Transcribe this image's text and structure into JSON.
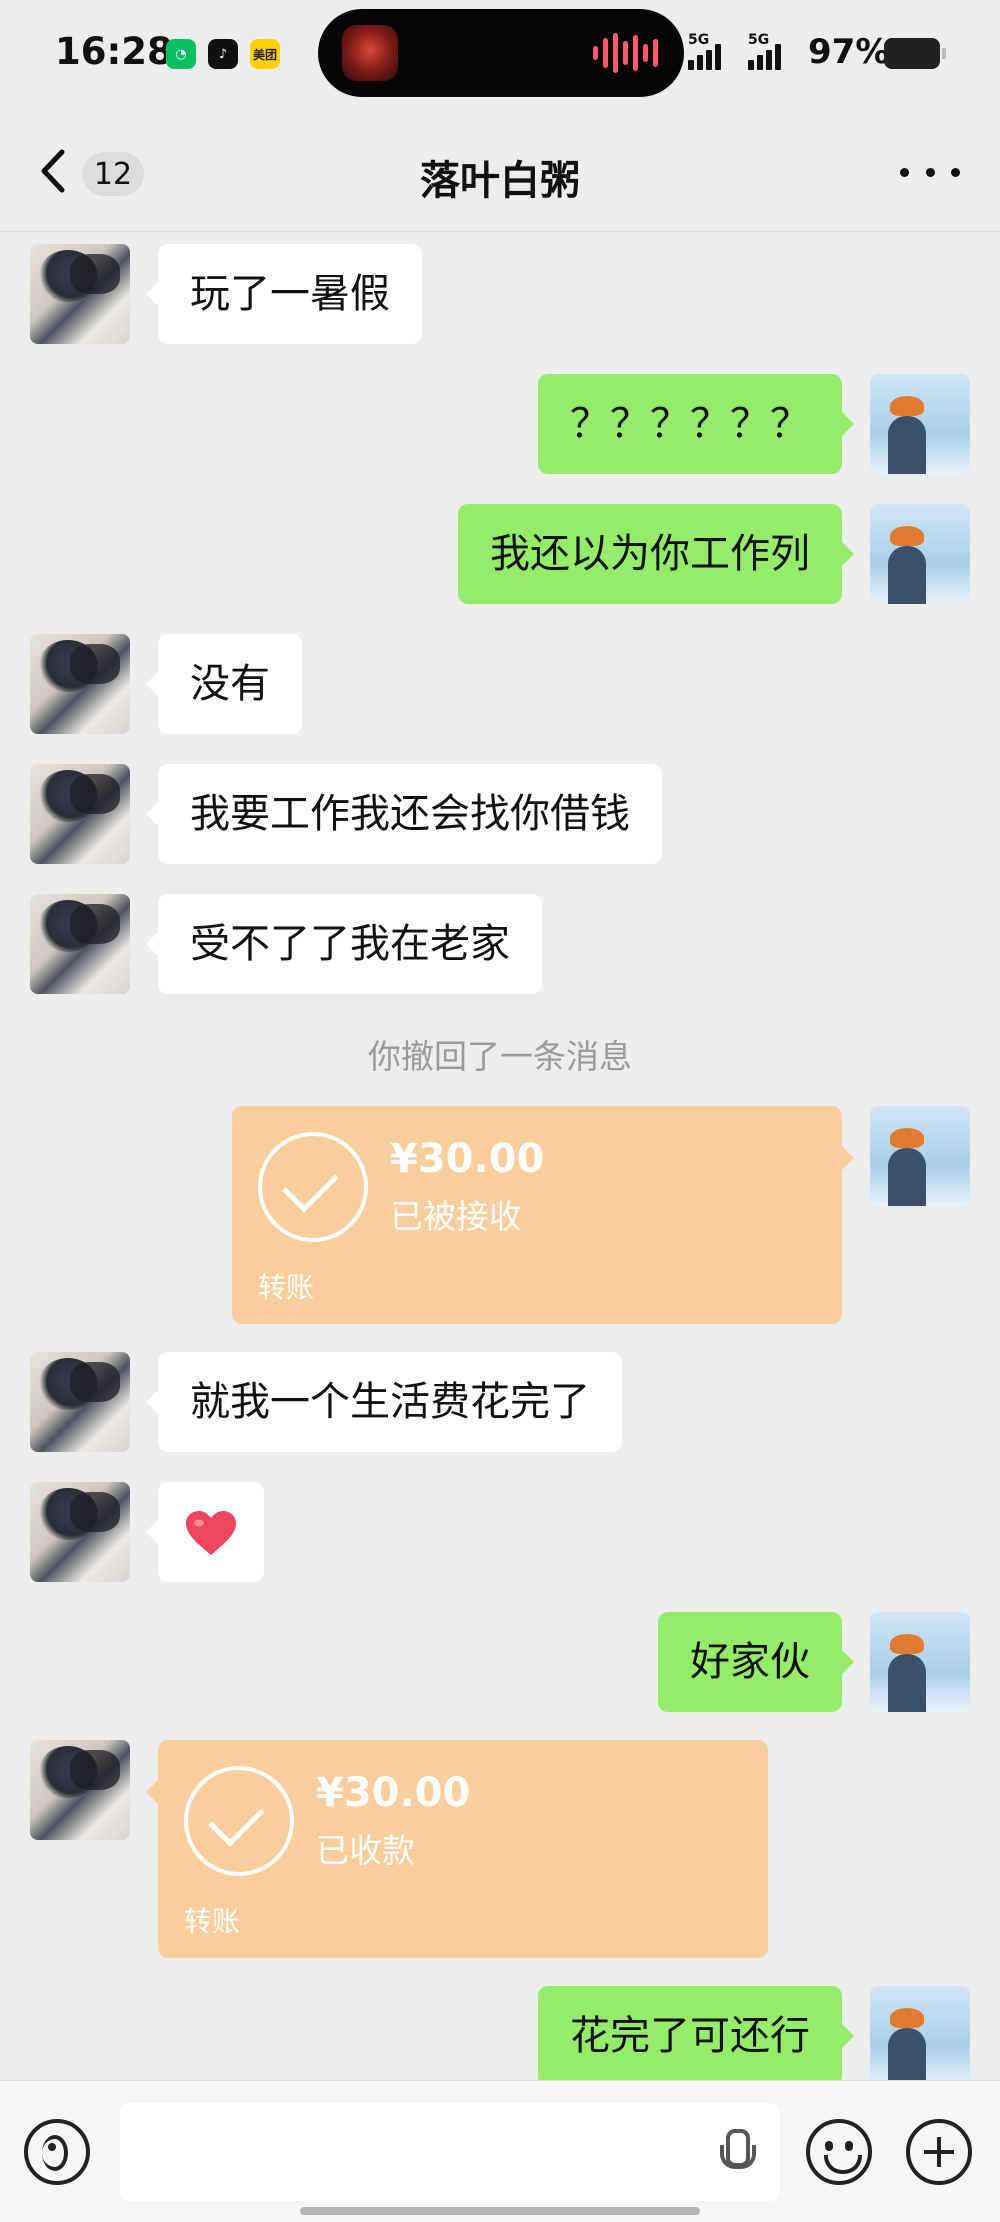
{
  "status_bar": {
    "time": "16:28",
    "app_icons": [
      {
        "name": "wechat-app-icon",
        "color": "#07c160",
        "glyph": "◔"
      },
      {
        "name": "tiktok-app-icon",
        "color": "#111111",
        "glyph": "♪"
      },
      {
        "name": "meituan-app-icon",
        "color": "#ffd100",
        "glyph": "美团"
      }
    ],
    "signal_label_1": "5G",
    "signal_label_2": "5G",
    "battery_percent": "97%",
    "battery_level": 0.97
  },
  "header": {
    "back_icon": "chevron-left-icon",
    "unread_count": "12",
    "title": "落叶白粥",
    "more_icon": "ellipsis-icon"
  },
  "messages": [
    {
      "sender": "friend",
      "type": "text",
      "text": "玩了一暑假"
    },
    {
      "sender": "me",
      "type": "text",
      "text": "？？？？？？"
    },
    {
      "sender": "me",
      "type": "text",
      "text": "我还以为你工作列"
    },
    {
      "sender": "friend",
      "type": "text",
      "text": "没有"
    },
    {
      "sender": "friend",
      "type": "text",
      "text": "我要工作我还会找你借钱"
    },
    {
      "sender": "friend",
      "type": "text",
      "text": "受不了了我在老家"
    },
    {
      "sender": "system",
      "type": "notice",
      "text": "你撤回了一条消息"
    },
    {
      "sender": "me",
      "type": "transfer",
      "amount": "¥30.00",
      "status": "已被接收",
      "label": "转账"
    },
    {
      "sender": "friend",
      "type": "text",
      "text": "就我一个生活费花完了"
    },
    {
      "sender": "friend",
      "type": "emoji",
      "text": "❤️"
    },
    {
      "sender": "me",
      "type": "text",
      "text": "好家伙"
    },
    {
      "sender": "friend",
      "type": "transfer",
      "amount": "¥30.00",
      "status": "已收款",
      "label": "转账"
    },
    {
      "sender": "me",
      "type": "text",
      "text": "花完了可还行"
    }
  ],
  "input_bar": {
    "voice_icon": "voice-icon",
    "input_value": "",
    "mic_icon": "microphone-icon",
    "emoji_icon": "smiley-icon",
    "plus_icon": "plus-icon"
  },
  "colors": {
    "background": "#ededed",
    "my_bubble": "#95ec69",
    "friend_bubble": "#ffffff",
    "transfer_card": "#f9ce9c",
    "system_text": "#9a9a9a"
  }
}
